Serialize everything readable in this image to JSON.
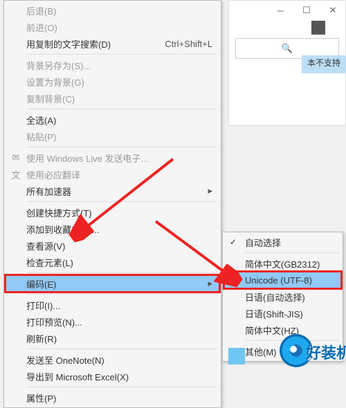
{
  "window": {
    "search_icon": "🔍",
    "tag_text": "本不支持"
  },
  "menu": {
    "back": "后退(B)",
    "forward": "前进(O)",
    "find_copied": "用复制的文字搜索(D)",
    "find_copied_shortcut": "Ctrl+Shift+L",
    "save_bg": "背景另存为(S)...",
    "set_bg": "设置为背景(G)",
    "copy_bg": "复制背景(C)",
    "select_all": "全选(A)",
    "paste": "粘贴(P)",
    "win_live": "使用 Windows Live 发送电子…",
    "bing_trans": "使用必应翻译",
    "accelerators": "所有加速器",
    "create_shortcut": "创建快捷方式(T)",
    "add_fav": "添加到收藏夹(F)...",
    "view_source": "查看源(V)",
    "inspect": "检查元素(L)",
    "encoding": "编码(E)",
    "print": "打印(I)...",
    "print_preview": "打印预览(N)...",
    "refresh": "刷新(R)",
    "send_onenote": "发送至 OneNote(N)",
    "export_excel": "导出到 Microsoft Excel(X)",
    "properties": "属性(P)"
  },
  "submenu": {
    "auto": "自动选择",
    "gb2312": "简体中文(GB2312)",
    "utf8": "Unicode (UTF-8)",
    "ja_auto": "日语(自动选择)",
    "shift_jis": "日语(Shift-JIS)",
    "hz": "简体中文(HZ)",
    "other": "其他(M)"
  },
  "brand": "好装机"
}
